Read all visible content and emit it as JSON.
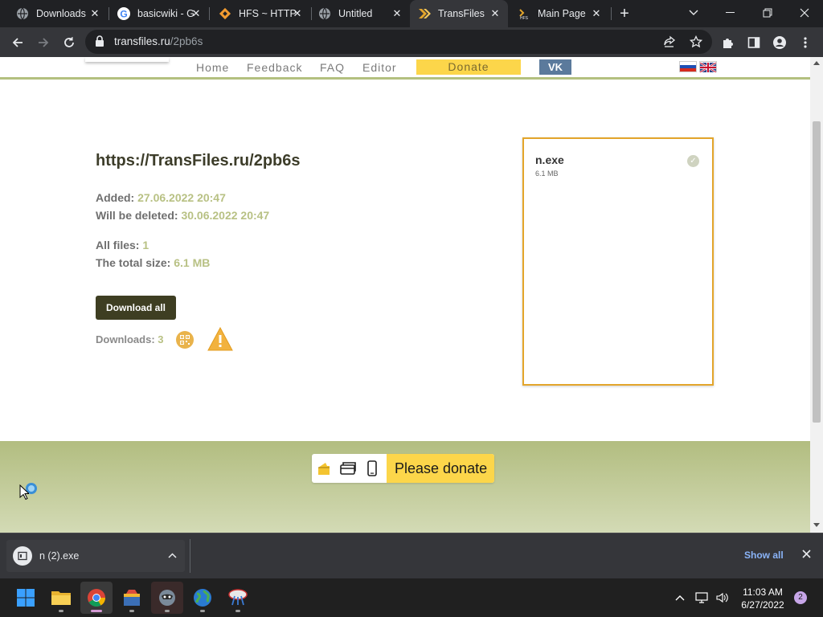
{
  "browser": {
    "tabs": [
      {
        "title": "Downloads",
        "icon": "downloads-globe-icon",
        "active": false
      },
      {
        "title": "basicwiki - G",
        "icon": "google-icon",
        "active": false
      },
      {
        "title": "HFS ~ HTTP",
        "icon": "hfs-diamond-icon",
        "active": false
      },
      {
        "title": "Untitled",
        "icon": "globe-icon",
        "active": false
      },
      {
        "title": "TransFiles",
        "icon": "transfiles-chevron-icon",
        "active": true
      },
      {
        "title": "Main Page",
        "icon": "hfs-page-icon",
        "active": false
      }
    ],
    "url_host": "transfiles.ru",
    "url_path": "/2pb6s"
  },
  "site": {
    "nav": [
      "Home",
      "Feedback",
      "FAQ",
      "Editor"
    ],
    "donate": "Donate",
    "vk": "VK"
  },
  "transfer": {
    "url_title": "https://TransFiles.ru/2pb6s",
    "added_label": "Added:",
    "added_value": "27.06.2022 20:47",
    "deleted_label": "Will be deleted:",
    "deleted_value": "30.06.2022 20:47",
    "files_label": "All files:",
    "files_value": "1",
    "size_label": "The total size:",
    "size_value": "6.1 MB",
    "download_all": "Download all",
    "downloads_label": "Downloads:",
    "downloads_value": "3"
  },
  "file": {
    "name": "n.exe",
    "size": "6.1 MB"
  },
  "footer": {
    "donate_label": "Please donate"
  },
  "shelf": {
    "item": "n (2).exe",
    "show_all": "Show all"
  },
  "taskbar": {
    "time": "11:03 AM",
    "date": "6/27/2022",
    "notifications": "2"
  }
}
